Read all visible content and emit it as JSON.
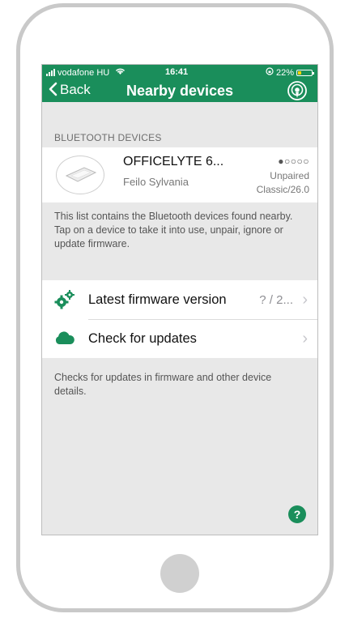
{
  "status_bar": {
    "carrier": "vodafone HU",
    "time": "16:41",
    "battery": "22%"
  },
  "nav": {
    "back_label": "Back",
    "title": "Nearby devices",
    "broadcast_icon": "broadcast-icon"
  },
  "section_header": "BLUETOOTH DEVICES",
  "device": {
    "name": "OFFICELYTE 6...",
    "manufacturer": "Feilo Sylvania",
    "signal_dots": "●○○○○",
    "pair_status": "Unpaired",
    "type": "Classic/26.0"
  },
  "description_devices": "This list contains the Bluetooth devices found nearby. Tap on a device to take it into use, unpair, ignore or update firmware.",
  "menu": [
    {
      "label": "Latest firmware version",
      "value": "? / 2...",
      "icon": "gears-icon"
    },
    {
      "label": "Check for updates",
      "value": "",
      "icon": "cloud-icon"
    }
  ],
  "description_updates": "Checks for updates in firmware and other device details.",
  "help_label": "?",
  "colors": {
    "accent": "#1a8e5b",
    "battery": "#ffd400"
  }
}
